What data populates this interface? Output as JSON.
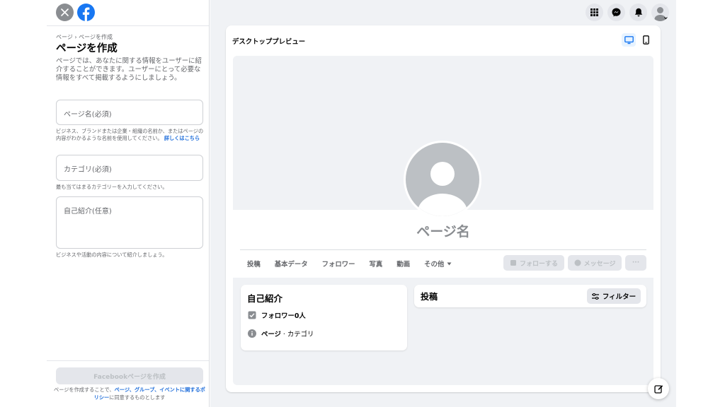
{
  "left": {
    "breadcrumb": "ページ › ページを作成",
    "title": "ページを作成",
    "description": "ページでは、あなたに関する情報をユーザーに紹介することができます。ユーザーにとって必要な情報をすべて掲載するようにしましょう。",
    "page_name_placeholder": "ページ名(必須)",
    "page_name_hint": "ビジネス、ブランドまたは企業・組織の名前か、またはページの内容がわかるような名前を使用してください。",
    "page_name_hint_link": "詳しくはこちら",
    "category_placeholder": "カテゴリ(必須)",
    "category_hint": "最も当てはまるカテゴリーを入力してください。",
    "bio_placeholder": "自己紹介(任意)",
    "bio_hint": "ビジネスや活動の内容について紹介しましょう。",
    "create_button": "Facebookページを作成",
    "policy_prefix": "ページを作成することで、",
    "policy_link": "ページ、グループ、イベントに関するポリシー",
    "policy_suffix": "に同意するものとします"
  },
  "preview": {
    "header": "デスクトッププレビュー",
    "page_name": "ページ名",
    "tabs": [
      "投稿",
      "基本データ",
      "フォロワー",
      "写真",
      "動画",
      "その他"
    ],
    "follow_button": "フォローする",
    "message_button": "メッセージ",
    "more_button": "···",
    "intro_title": "自己紹介",
    "followers_text": "フォロワー0人",
    "category_bold": "ページ",
    "category_text": " · カテゴリ",
    "posts_title": "投稿",
    "filter_button": "フィルター"
  },
  "icons": {
    "top_left": [
      "close-icon",
      "facebook-logo"
    ],
    "top_right": [
      "menu-grid-icon",
      "messenger-icon",
      "bell-icon",
      "account-avatar"
    ],
    "device": [
      "desktop-icon",
      "mobile-icon"
    ]
  },
  "colors": {
    "brand_blue": "#1877f2",
    "link_blue": "#216fdb",
    "background_gray": "#f0f2f5",
    "disabled_gray": "#e4e6eb"
  }
}
